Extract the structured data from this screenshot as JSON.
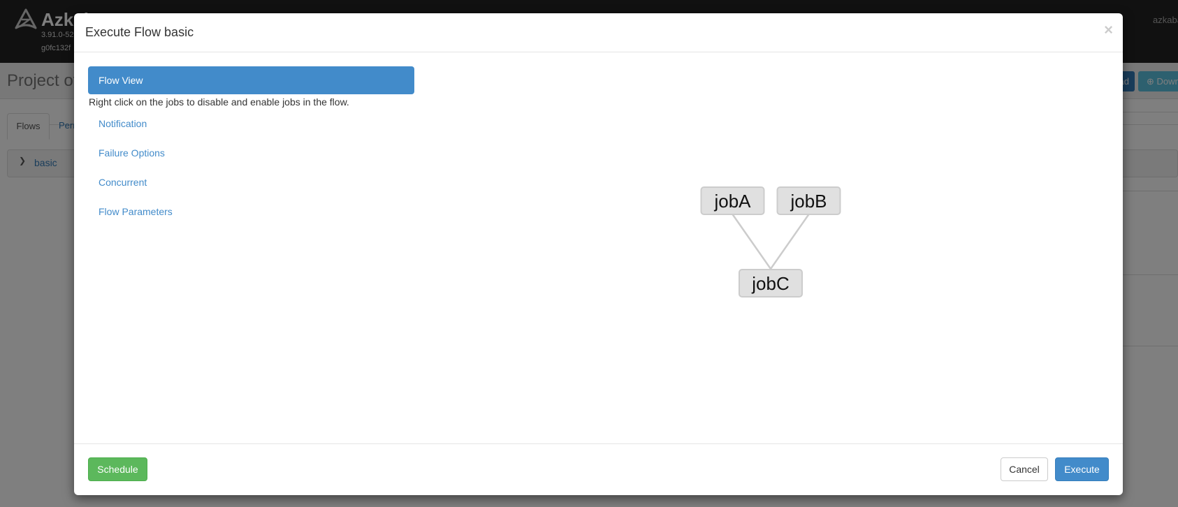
{
  "background": {
    "navbar": {
      "brand": "Azkaban",
      "version": "3.91.0-52",
      "commit": "g0fc132f",
      "user": "azkaban"
    },
    "page": {
      "project_title": "Project of",
      "upload_label": "Upload",
      "download_label": "Download",
      "tabs": [
        {
          "label": "Flows",
          "active": true
        },
        {
          "label": "Permissions",
          "active": false
        }
      ],
      "flows": [
        {
          "name": "basic"
        }
      ]
    }
  },
  "modal": {
    "title": "Execute Flow basic",
    "close_label": "×",
    "nav": {
      "active": {
        "label": "Flow View"
      },
      "hint": "Right click on the jobs to disable and enable jobs in the flow.",
      "items": [
        {
          "label": "Notification"
        },
        {
          "label": "Failure Options"
        },
        {
          "label": "Concurrent"
        },
        {
          "label": "Flow Parameters"
        }
      ]
    },
    "graph": {
      "nodes": [
        {
          "id": "jobA",
          "label": "jobA"
        },
        {
          "id": "jobB",
          "label": "jobB"
        },
        {
          "id": "jobC",
          "label": "jobC"
        }
      ],
      "edges": [
        {
          "from": "jobA",
          "to": "jobC"
        },
        {
          "from": "jobB",
          "to": "jobC"
        }
      ]
    },
    "footer": {
      "schedule_label": "Schedule",
      "cancel_label": "Cancel",
      "execute_label": "Execute"
    }
  },
  "colors": {
    "primary": "#428bca",
    "success": "#5cb85c",
    "navbar": "#222222",
    "node_fill": "#e0e0e0",
    "node_stroke": "#cccccc",
    "edge": "#cccccc"
  }
}
